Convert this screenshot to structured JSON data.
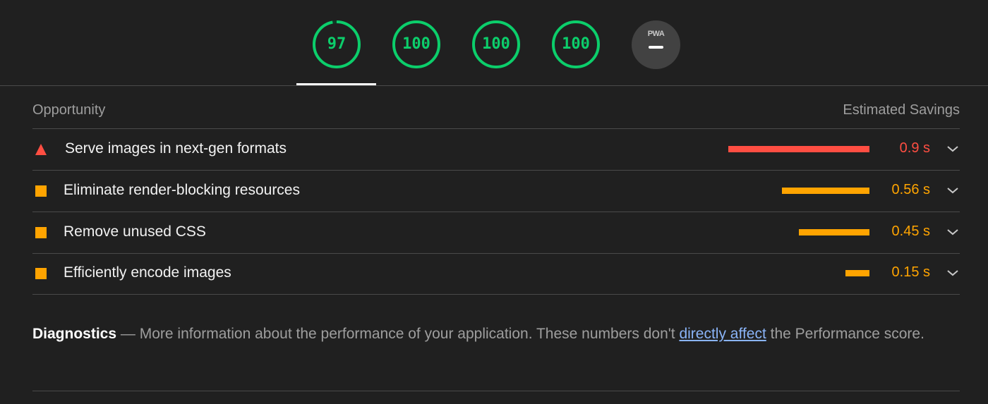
{
  "gauges": [
    {
      "score": "97",
      "value": 0.97,
      "color": "#0cce6b"
    },
    {
      "score": "100",
      "value": 1.0,
      "color": "#0cce6b"
    },
    {
      "score": "100",
      "value": 1.0,
      "color": "#0cce6b"
    },
    {
      "score": "100",
      "value": 1.0,
      "color": "#0cce6b"
    }
  ],
  "pwa": {
    "label": "PWA"
  },
  "table": {
    "col_left": "Opportunity",
    "col_right": "Estimated Savings"
  },
  "audits": [
    {
      "title": "Serve images in next-gen formats",
      "savings": "0.9 s",
      "severity": "fail",
      "icon": "triangle-icon",
      "color": "#ff4e42",
      "fraction": 1.0
    },
    {
      "title": "Eliminate render-blocking resources",
      "savings": "0.56 s",
      "severity": "average",
      "icon": "square-icon",
      "color": "#ffa400",
      "fraction": 0.62
    },
    {
      "title": "Remove unused CSS",
      "savings": "0.45 s",
      "severity": "average",
      "icon": "square-icon",
      "color": "#ffa400",
      "fraction": 0.5
    },
    {
      "title": "Efficiently encode images",
      "savings": "0.15 s",
      "severity": "average",
      "icon": "square-icon",
      "color": "#ffa400",
      "fraction": 0.17
    }
  ],
  "diagnostics": {
    "title": "Diagnostics",
    "separator": "—",
    "text_before": "More information about the performance of your application. These numbers don't",
    "link": "directly affect",
    "text_after": "the Performance score."
  }
}
